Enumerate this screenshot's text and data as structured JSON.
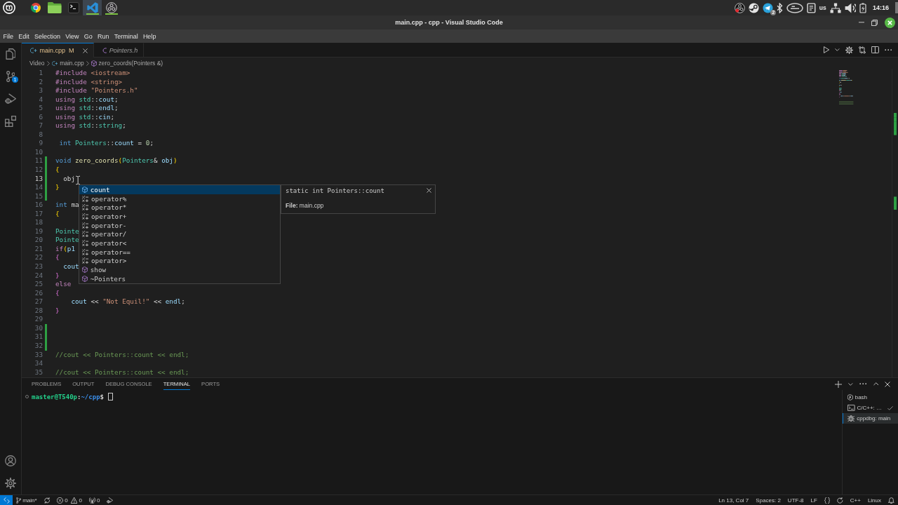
{
  "desktop_panel": {
    "apps": [
      {
        "kind": "browser",
        "selected": false,
        "running": false
      },
      {
        "kind": "files",
        "selected": false,
        "running": false
      },
      {
        "kind": "terminal",
        "selected": false,
        "running": false
      },
      {
        "kind": "editor",
        "selected": true,
        "running": true
      },
      {
        "kind": "recorder",
        "selected": false,
        "running": true
      }
    ],
    "tray": [
      {
        "kind": "recorder"
      },
      {
        "kind": "steam"
      },
      {
        "kind": "messenger",
        "badge": "2"
      },
      {
        "kind": "bluetooth"
      },
      {
        "kind": "chip"
      },
      {
        "kind": "clipboard"
      },
      {
        "kind": "keyboard_layout",
        "text": "us"
      },
      {
        "kind": "network"
      },
      {
        "kind": "volume"
      },
      {
        "kind": "battery"
      }
    ],
    "clock": "14:16"
  },
  "window": {
    "title": "main.cpp - cpp - Visual Studio Code"
  },
  "menu": [
    "File",
    "Edit",
    "Selection",
    "View",
    "Go",
    "Run",
    "Terminal",
    "Help"
  ],
  "activity_bar": {
    "top": [
      {
        "kind": "explorer"
      },
      {
        "kind": "source_control",
        "badge": "1"
      },
      {
        "kind": "run_debug"
      },
      {
        "kind": "extensions"
      }
    ],
    "bottom": [
      {
        "kind": "account"
      },
      {
        "kind": "settings"
      }
    ]
  },
  "tabs": [
    {
      "label": "main.cpp",
      "kind": "cpp",
      "status": "M",
      "modified": true,
      "preview": false,
      "selected": true
    },
    {
      "label": "Pointers.h",
      "kind": "header",
      "modified": false,
      "preview": true,
      "selected": false
    }
  ],
  "editor_actions": [
    {
      "kind": "run"
    },
    {
      "kind": "dropdown"
    },
    {
      "kind": "settings"
    },
    {
      "kind": "compare"
    },
    {
      "kind": "split"
    },
    {
      "kind": "more"
    }
  ],
  "breadcrumbs": [
    {
      "text": "Video",
      "kind": "folder"
    },
    {
      "text": "main.cpp",
      "kind": "cpp"
    },
    {
      "text": "zero_coords(Pointers &)",
      "kind": "function"
    }
  ],
  "editor": {
    "lines": [
      {
        "number": "1",
        "modified": false,
        "current": false,
        "tokens": [
          {
            "text": "#include ",
            "kind": "preprocessor"
          },
          {
            "text": "<iostream>",
            "kind": "include"
          }
        ]
      },
      {
        "number": "2",
        "modified": false,
        "current": false,
        "tokens": [
          {
            "text": "#include ",
            "kind": "preprocessor"
          },
          {
            "text": "<string>",
            "kind": "include"
          }
        ]
      },
      {
        "number": "3",
        "modified": false,
        "current": false,
        "tokens": [
          {
            "text": "#include ",
            "kind": "preprocessor"
          },
          {
            "text": "\"Pointers.h\"",
            "kind": "include"
          }
        ]
      },
      {
        "number": "4",
        "modified": false,
        "current": false,
        "tokens": [
          {
            "text": "using ",
            "kind": "control"
          },
          {
            "text": "std",
            "kind": "type"
          },
          {
            "text": "::",
            "kind": "plain"
          },
          {
            "text": "cout",
            "kind": "variable"
          },
          {
            "text": ";",
            "kind": "plain"
          }
        ]
      },
      {
        "number": "5",
        "modified": false,
        "current": false,
        "tokens": [
          {
            "text": "using ",
            "kind": "control"
          },
          {
            "text": "std",
            "kind": "type"
          },
          {
            "text": "::",
            "kind": "plain"
          },
          {
            "text": "endl",
            "kind": "variable"
          },
          {
            "text": ";",
            "kind": "plain"
          }
        ]
      },
      {
        "number": "6",
        "modified": false,
        "current": false,
        "tokens": [
          {
            "text": "using ",
            "kind": "control"
          },
          {
            "text": "std",
            "kind": "type"
          },
          {
            "text": "::",
            "kind": "plain"
          },
          {
            "text": "cin",
            "kind": "variable"
          },
          {
            "text": ";",
            "kind": "plain"
          }
        ]
      },
      {
        "number": "7",
        "modified": false,
        "current": false,
        "tokens": [
          {
            "text": "using ",
            "kind": "control"
          },
          {
            "text": "std",
            "kind": "type"
          },
          {
            "text": "::",
            "kind": "plain"
          },
          {
            "text": "string",
            "kind": "type"
          },
          {
            "text": ";",
            "kind": "plain"
          }
        ]
      },
      {
        "number": "8",
        "modified": false,
        "current": false
      },
      {
        "number": "9",
        "modified": false,
        "current": false,
        "tokens": [
          {
            "text": " int ",
            "kind": "keyword"
          },
          {
            "text": "Pointers",
            "kind": "type"
          },
          {
            "text": "::",
            "kind": "plain"
          },
          {
            "text": "count",
            "kind": "variable"
          },
          {
            "text": " = ",
            "kind": "plain"
          },
          {
            "text": "0",
            "kind": "number"
          },
          {
            "text": ";",
            "kind": "plain"
          }
        ]
      },
      {
        "number": "10",
        "modified": false,
        "current": false
      },
      {
        "number": "11",
        "modified": true,
        "current": false,
        "tokens": [
          {
            "text": "void ",
            "kind": "keyword"
          },
          {
            "text": "zero_coords",
            "kind": "function"
          },
          {
            "text": "(",
            "kind": "bracket1"
          },
          {
            "text": "Pointers",
            "kind": "type"
          },
          {
            "text": "& ",
            "kind": "plain"
          },
          {
            "text": "obj",
            "kind": "variable"
          },
          {
            "text": ")",
            "kind": "bracket1"
          }
        ]
      },
      {
        "number": "12",
        "modified": true,
        "current": false,
        "tokens": [
          {
            "text": "{",
            "kind": "bracket1"
          }
        ]
      },
      {
        "number": "13",
        "modified": true,
        "current": true,
        "tokens": [
          {
            "text": "  obj",
            "kind": "plain"
          }
        ]
      },
      {
        "number": "14",
        "modified": true,
        "current": false,
        "tokens": [
          {
            "text": "}",
            "kind": "bracket1"
          }
        ]
      },
      {
        "number": "15",
        "modified": true,
        "current": false
      },
      {
        "number": "16",
        "modified": false,
        "current": false,
        "tokens": [
          {
            "text": "int",
            "kind": "keyword"
          },
          {
            "text": " ma",
            "kind": "plain"
          }
        ]
      },
      {
        "number": "17",
        "modified": false,
        "current": false,
        "tokens": [
          {
            "text": "{",
            "kind": "bracket1"
          }
        ]
      },
      {
        "number": "18",
        "modified": false,
        "current": false
      },
      {
        "number": "19",
        "modified": false,
        "current": false,
        "tokens": [
          {
            "text": "Pointe",
            "kind": "type"
          }
        ]
      },
      {
        "number": "20",
        "modified": false,
        "current": false,
        "tokens": [
          {
            "text": "Pointe",
            "kind": "type"
          }
        ]
      },
      {
        "number": "21",
        "modified": false,
        "current": false,
        "tokens": [
          {
            "text": "if",
            "kind": "control"
          },
          {
            "text": "(",
            "kind": "bracket1"
          },
          {
            "text": "p1",
            "kind": "variable"
          }
        ]
      },
      {
        "number": "22",
        "modified": false,
        "current": false,
        "tokens": [
          {
            "text": "{",
            "kind": "bracket2"
          }
        ]
      },
      {
        "number": "23",
        "modified": false,
        "current": false,
        "tokens": [
          {
            "text": "  cout",
            "kind": "variable"
          }
        ]
      },
      {
        "number": "24",
        "modified": false,
        "current": false,
        "tokens": [
          {
            "text": "}",
            "kind": "bracket2"
          }
        ]
      },
      {
        "number": "25",
        "modified": false,
        "current": false,
        "tokens": [
          {
            "text": "else",
            "kind": "control"
          }
        ]
      },
      {
        "number": "26",
        "modified": false,
        "current": false,
        "tokens": [
          {
            "text": "{",
            "kind": "bracket2"
          }
        ]
      },
      {
        "number": "27",
        "modified": false,
        "current": false,
        "tokens": [
          {
            "text": "    cout",
            "kind": "variable"
          },
          {
            "text": " << ",
            "kind": "plain"
          },
          {
            "text": "\"Not Equil!\"",
            "kind": "string"
          },
          {
            "text": " << ",
            "kind": "plain"
          },
          {
            "text": "endl",
            "kind": "variable"
          },
          {
            "text": ";",
            "kind": "plain"
          }
        ]
      },
      {
        "number": "28",
        "modified": false,
        "current": false,
        "tokens": [
          {
            "text": "}",
            "kind": "bracket2"
          }
        ]
      },
      {
        "number": "29",
        "modified": false,
        "current": false
      },
      {
        "number": "30",
        "modified": true,
        "current": false
      },
      {
        "number": "31",
        "modified": true,
        "current": false
      },
      {
        "number": "32",
        "modified": true,
        "current": false
      },
      {
        "number": "33",
        "modified": false,
        "current": false,
        "tokens": [
          {
            "text": "//cout << Pointers::count << endl;",
            "kind": "comment"
          }
        ]
      },
      {
        "number": "34",
        "modified": false,
        "current": false
      },
      {
        "number": "35",
        "modified": false,
        "current": false,
        "tokens": [
          {
            "text": "//cout << Pointers::count << endl;",
            "kind": "comment"
          }
        ]
      }
    ]
  },
  "suggestions": {
    "items": [
      {
        "label": "count",
        "kind": "field",
        "selected": true
      },
      {
        "label": "operator%",
        "kind": "operator",
        "selected": false
      },
      {
        "label": "operator*",
        "kind": "operator",
        "selected": false
      },
      {
        "label": "operator+",
        "kind": "operator",
        "selected": false
      },
      {
        "label": "operator-",
        "kind": "operator",
        "selected": false
      },
      {
        "label": "operator/",
        "kind": "operator",
        "selected": false
      },
      {
        "label": "operator<",
        "kind": "operator",
        "selected": false
      },
      {
        "label": "operator==",
        "kind": "operator",
        "selected": false
      },
      {
        "label": "operator>",
        "kind": "operator",
        "selected": false
      },
      {
        "label": "show",
        "kind": "method",
        "selected": false
      },
      {
        "label": "~Pointers",
        "kind": "method",
        "selected": false
      }
    ],
    "detail": {
      "signature": "static int Pointers::count",
      "file": "**File:** main.cpp"
    }
  },
  "panel": {
    "tabs": [
      {
        "label": "PROBLEMS",
        "selected": false
      },
      {
        "label": "OUTPUT",
        "selected": false
      },
      {
        "label": "DEBUG CONSOLE",
        "selected": false
      },
      {
        "label": "TERMINAL",
        "selected": true
      },
      {
        "label": "PORTS",
        "selected": false
      }
    ],
    "actions": [
      {
        "kind": "add"
      },
      {
        "kind": "dropdown"
      },
      {
        "kind": "more"
      },
      {
        "kind": "maximize"
      },
      {
        "kind": "close"
      }
    ],
    "terminal": {
      "prompt": [
        {
          "text": "master@T540p",
          "kind": "user"
        },
        {
          "text": ":",
          "kind": "plain"
        },
        {
          "text": "~/cpp",
          "kind": "path"
        },
        {
          "text": "$",
          "kind": "plain"
        }
      ]
    },
    "terminals": [
      {
        "label": "bash",
        "kind": "shell",
        "done": false,
        "selected": false
      },
      {
        "label": "C/C++: …",
        "kind": "task",
        "done": true,
        "selected": false
      },
      {
        "label": "cppdbg: main",
        "kind": "debug",
        "done": false,
        "selected": true
      }
    ]
  },
  "status_bar": {
    "left": [
      {
        "kind": "remote"
      },
      {
        "kind": "branch",
        "text": "main*"
      },
      {
        "kind": "sync"
      },
      {
        "kind": "problems",
        "errors": "0",
        "warnings": "0"
      },
      {
        "kind": "ports",
        "text": "0"
      },
      {
        "kind": "debug"
      }
    ],
    "right": [
      {
        "kind": "text",
        "text": "Ln 13, Col 7"
      },
      {
        "kind": "text",
        "text": "Spaces: 2"
      },
      {
        "kind": "text",
        "text": "UTF-8"
      },
      {
        "kind": "text",
        "text": "LF"
      },
      {
        "kind": "braces"
      },
      {
        "kind": "loop"
      },
      {
        "kind": "text",
        "text": "C++"
      },
      {
        "kind": "text",
        "text": "Linux"
      },
      {
        "kind": "bell"
      }
    ]
  }
}
